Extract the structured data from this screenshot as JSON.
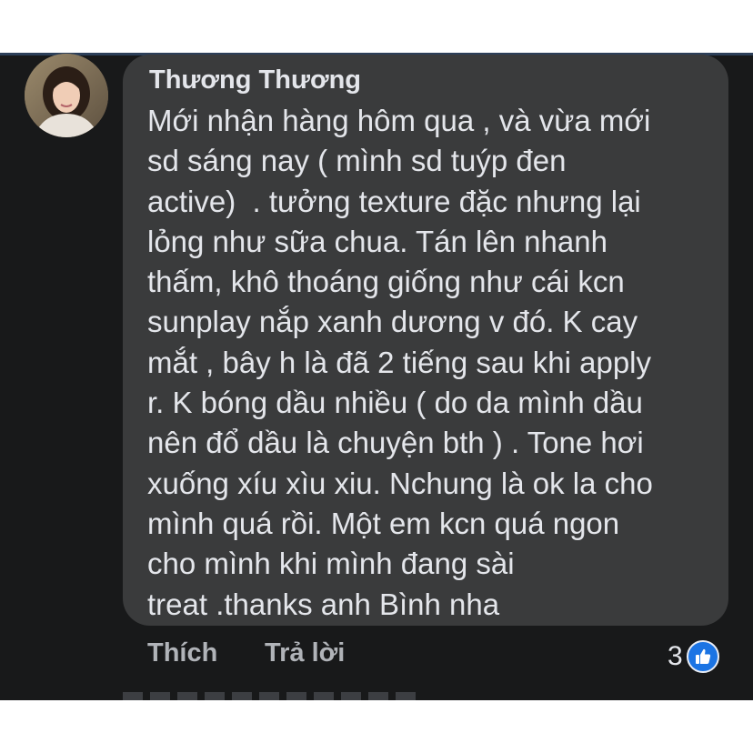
{
  "comment": {
    "author": "Thương Thương",
    "avatar_icon": "user-avatar",
    "lines": [
      "Mới nhận hàng hôm qua , và vừa mới",
      "sd sáng nay ( mình sd tuýp đen",
      "active)  . tưởng texture đặc nhưng lại",
      "lỏng như sữa chua. Tán lên nhanh",
      "thấm, khô thoáng giống như cái kcn",
      "sunplay nắp xanh dương v đó. K cay",
      "mắt , bây h là đã 2 tiếng sau khi apply",
      "r. K bóng dầu nhiều ( do da mình dầu",
      "nên đổ dầu là chuyện bth ) . Tone hơi",
      "xuống xíu xìu xiu. Nchung là ok la cho",
      "mình quá rồi. Một em kcn quá ngon",
      "cho mình khi mình đang sài",
      "treat .thanks anh Bình nha"
    ]
  },
  "actions": {
    "like_label": "Thích",
    "reply_label": "Trả lời"
  },
  "reactions": {
    "count": "3",
    "icon": "like-thumb-icon"
  },
  "colors": {
    "background": "#18191a",
    "bubble": "#3a3b3c",
    "text": "#e4e6eb",
    "secondary_text": "#b0b3b8",
    "like_blue": "#1b74e4"
  }
}
